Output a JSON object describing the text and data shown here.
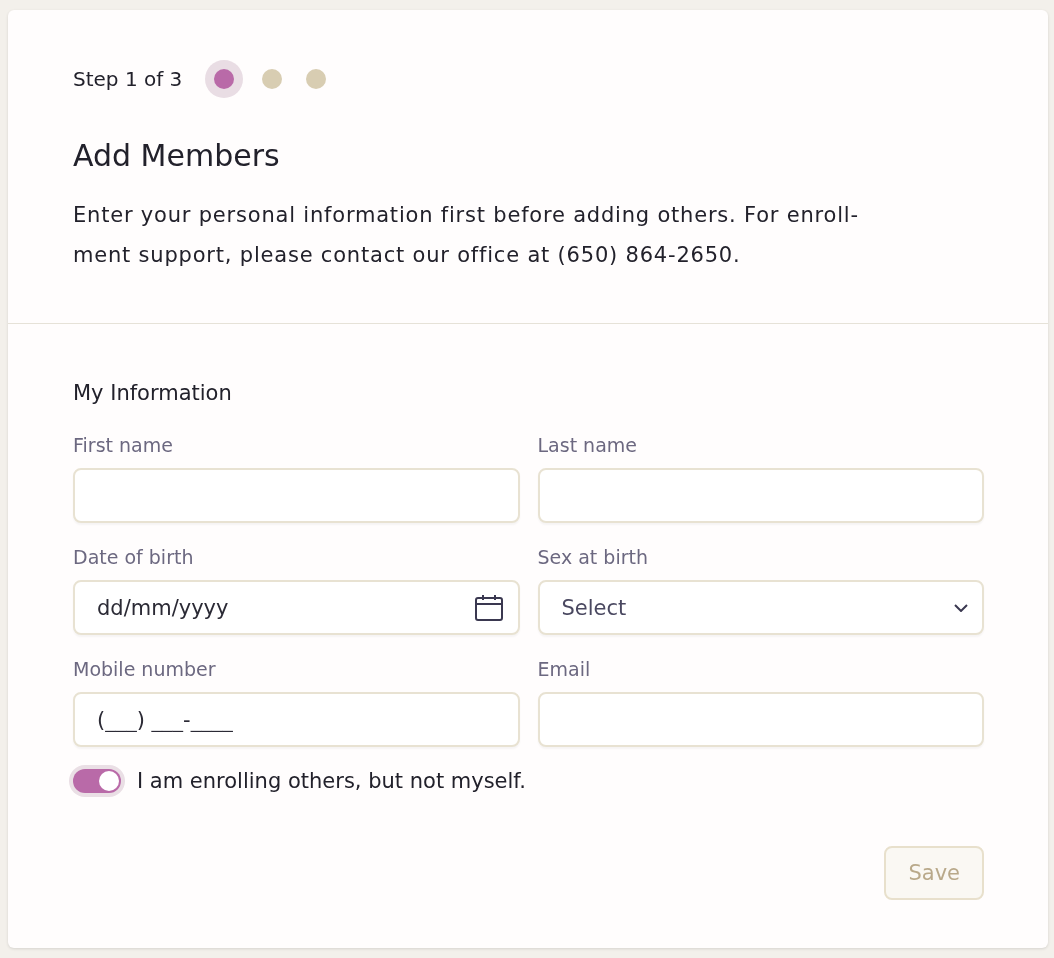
{
  "stepper": {
    "label": "Step 1 of 3",
    "steps": [
      {
        "selected": true
      },
      {
        "selected": false
      },
      {
        "selected": false
      }
    ]
  },
  "title": "Add Members",
  "description": "Enter your personal information first before adding others. For enroll-ment support, please contact our office at (650) 864-2650.",
  "section_title": "My Information",
  "fields": [
    {
      "kind": "text",
      "label": "First name"
    },
    {
      "kind": "text",
      "label": "Last name"
    },
    {
      "kind": "date",
      "label": "Date of birth",
      "placeholder": "dd/mm/yyyy"
    },
    {
      "kind": "select",
      "label": "Sex at birth",
      "placeholder": "Select"
    },
    {
      "kind": "text",
      "label": "Mobile number",
      "placeholder": "(___) ___-____"
    },
    {
      "kind": "text",
      "label": "Email"
    }
  ],
  "toggle": {
    "label": "I am enrolling others, but not myself.",
    "on": true
  },
  "save_button": {
    "label": "Save",
    "disabled": true
  }
}
